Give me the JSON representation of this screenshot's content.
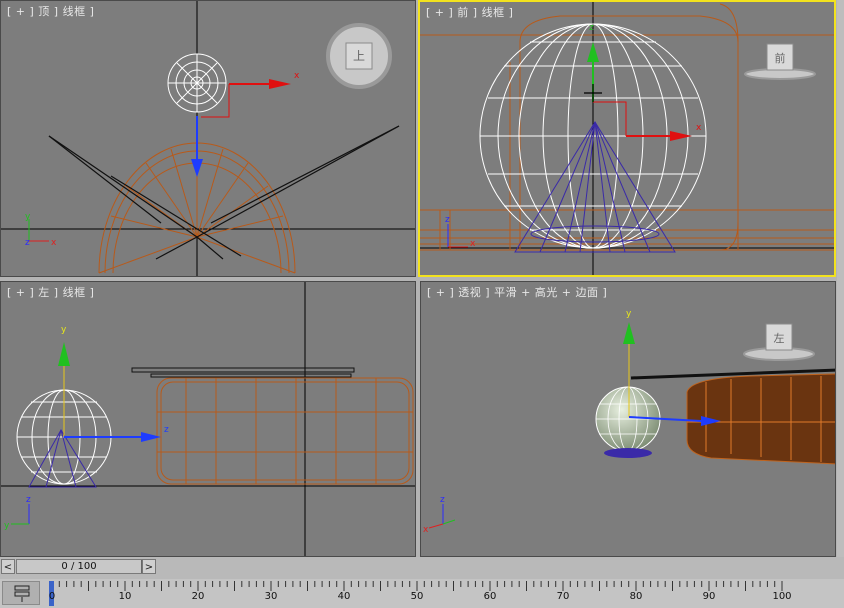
{
  "viewports": {
    "top": {
      "label": "[ + ] 顶 ] 线框 ]"
    },
    "front": {
      "label": "[ + ] 前 ] 线框 ]"
    },
    "left": {
      "label": "[ + ] 左 ] 线框 ]"
    },
    "perspective": {
      "label": "[ + ] 透视 ] 平滑 + 高光 + 边面 ]"
    }
  },
  "view_cube": {
    "top": "上",
    "front": "前",
    "left": "左"
  },
  "axis": {
    "x": "x",
    "y": "y",
    "z": "z"
  },
  "time_slider": {
    "value": "0 / 100",
    "prev": "<",
    "next": ">"
  },
  "track_bar": {
    "ticks": [
      "0",
      "10",
      "20",
      "30",
      "40",
      "50",
      "60",
      "70",
      "80",
      "90",
      "100"
    ]
  },
  "colors": {
    "viewport_bg": "#7d7d7d",
    "active_border": "#f2e21e",
    "wire_selected": "#ffffff",
    "wire_object": "#c0641e",
    "wire_cone": "#3a2aa8"
  }
}
